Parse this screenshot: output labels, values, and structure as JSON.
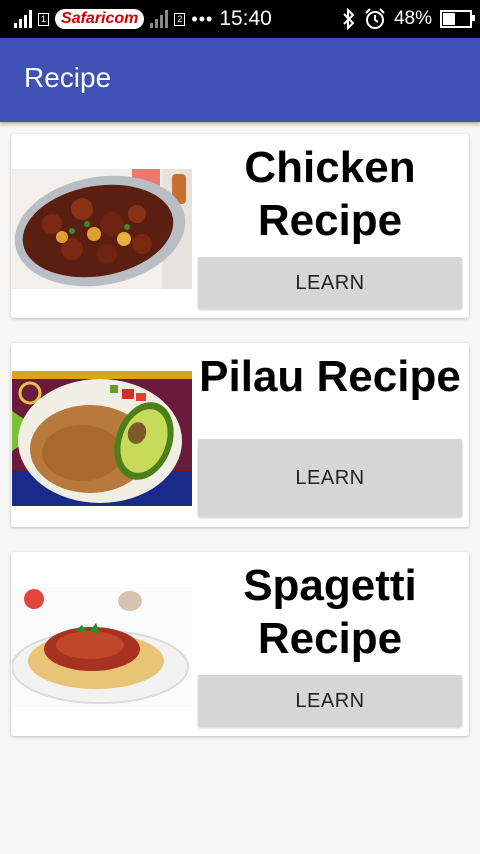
{
  "status_bar": {
    "carrier": "Safaricom",
    "dots": "•••",
    "time": "15:40",
    "battery_text": "48%",
    "battery_level": 0.48,
    "icons": [
      "signal-icon",
      "sim1-icon",
      "signal-icon",
      "sim2-icon",
      "bluetooth-icon",
      "alarm-icon",
      "battery-icon"
    ]
  },
  "app_bar": {
    "title": "Recipe"
  },
  "recipes": [
    {
      "title_line1": "Chicken",
      "title_line2": "Recipe",
      "button": "LEARN",
      "image": "chicken-dish"
    },
    {
      "title_line1": "Pilau Recipe",
      "button": "LEARN",
      "image": "pilau-dish"
    },
    {
      "title_line1": "Spagetti",
      "title_line2": "Recipe",
      "button": "LEARN",
      "image": "spaghetti-dish"
    }
  ],
  "colors": {
    "primary": "#3f51b5",
    "button": "#d6d6d6",
    "background": "#f7f7f7"
  }
}
